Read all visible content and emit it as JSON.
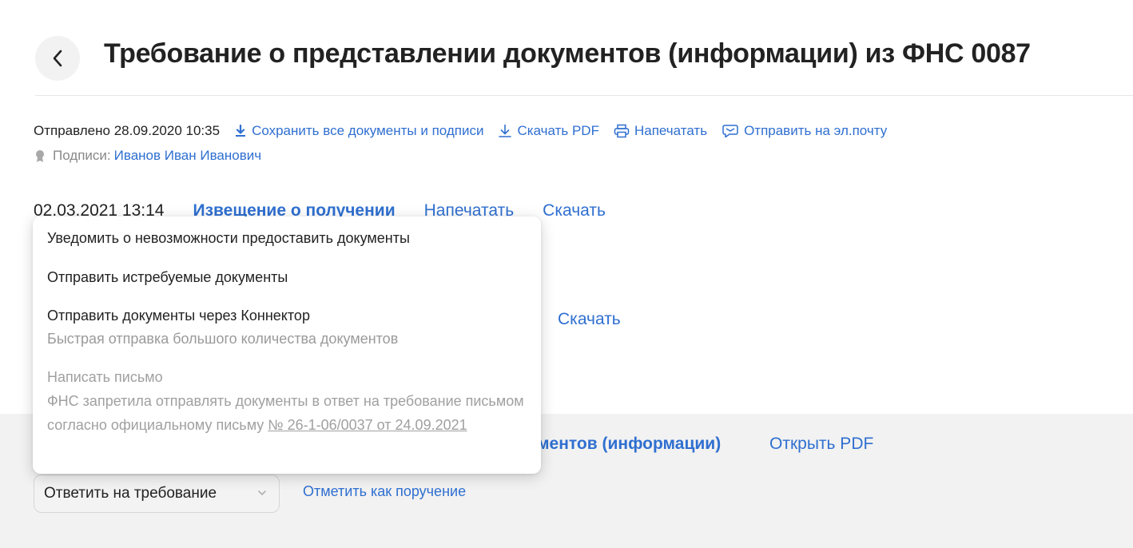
{
  "header": {
    "title": "Требование о представлении документов (информации) из ФНС 0087"
  },
  "meta": {
    "sent": "Отправлено 28.09.2020 10:35",
    "actions": {
      "save_all": "Сохранить все документы и подписи",
      "download_pdf": "Скачать PDF",
      "print": "Напечатать",
      "email": "Отправить на эл.почту"
    },
    "signs_label": "Подписи:",
    "signer": "Иванов Иван Иванович"
  },
  "event": {
    "date": "02.03.2021 13:14",
    "title": "Извещение о получении",
    "print": "Напечатать",
    "download": "Скачать"
  },
  "second_download": "Скачать",
  "document": {
    "title_fragment": "ментов (информации)",
    "open_pdf": "Открыть PDF"
  },
  "reply": {
    "select_value": "Ответить на требование",
    "mark_assignment": "Отметить как поручение"
  },
  "dropdown": {
    "items": [
      {
        "label": "Уведомить о невозможности предоставить документы"
      },
      {
        "label": "Отправить истребуемые документы"
      },
      {
        "label": "Отправить документы через Коннектор",
        "sub": "Быстрая отправка большого количества документов"
      },
      {
        "label": "Написать письмо",
        "desc_prefix": "ФНС запретила отправлять документы в ответ на требование письмом согласно официальному письму ",
        "desc_link": "№ 26-1-06/0037 от 24.09.2021",
        "disabled": true
      }
    ]
  }
}
